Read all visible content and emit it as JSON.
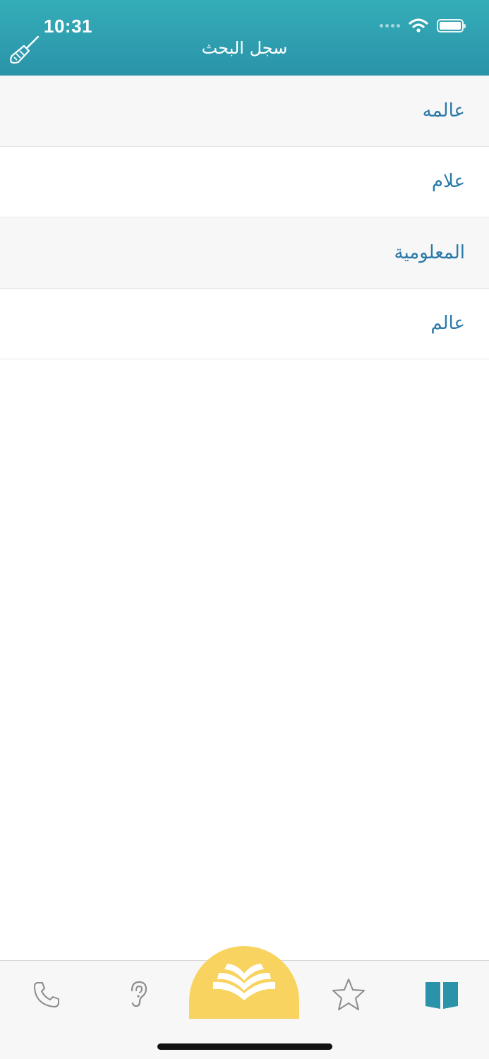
{
  "status_bar": {
    "time": "10:31"
  },
  "header": {
    "title": "سجل البحث",
    "clear_icon": "broom-icon"
  },
  "history": [
    {
      "word": "عالمه"
    },
    {
      "word": "علام"
    },
    {
      "word": "المعلومية"
    },
    {
      "word": "عالم"
    }
  ],
  "tab_bar": {
    "tabs": [
      {
        "icon": "phone-icon"
      },
      {
        "icon": "ear-icon"
      },
      {
        "icon": "open-book-logo-icon"
      },
      {
        "icon": "star-icon"
      },
      {
        "icon": "book-icon"
      }
    ],
    "active_color": "#2a93a9",
    "center_color": "#f9d35f"
  },
  "colors": {
    "header_top": "#35adb8",
    "header_bottom": "#2a93a9",
    "word_text": "#2a79a8"
  }
}
